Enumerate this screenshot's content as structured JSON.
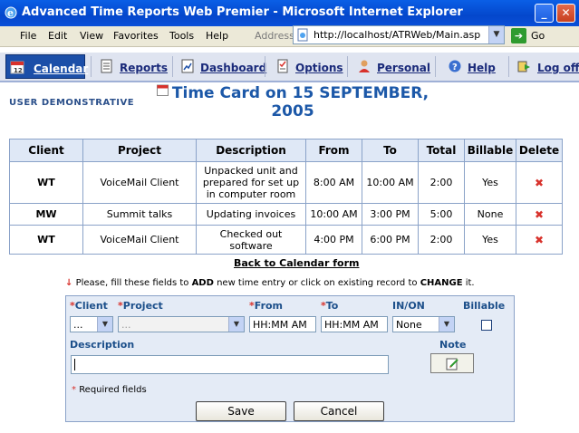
{
  "window": {
    "title": "Advanced Time Reports Web Premier - Microsoft Internet Explorer"
  },
  "menu": {
    "items": [
      "File",
      "Edit",
      "View",
      "Favorites",
      "Tools",
      "Help"
    ],
    "address_label": "Address",
    "url": "http://localhost/ATRWeb/Main.asp",
    "go_label": "Go"
  },
  "nav": {
    "tabs": [
      {
        "label": "Calendar",
        "icon": "calendar-icon",
        "active": true
      },
      {
        "label": "Reports",
        "icon": "document-icon"
      },
      {
        "label": "Dashboard",
        "icon": "chart-icon"
      },
      {
        "label": "Options",
        "icon": "checklist-icon"
      },
      {
        "label": "Personal",
        "icon": "person-icon"
      },
      {
        "label": "Help",
        "icon": "help-icon"
      },
      {
        "label": "Log off -",
        "icon": "logoff-icon"
      }
    ]
  },
  "header": {
    "user": "USER DEMONSTRATIVE",
    "title_line1": "Time Card on 15 SEPTEMBER,",
    "title_line2": "2005"
  },
  "table": {
    "headers": [
      "Client",
      "Project",
      "Description",
      "From",
      "To",
      "Total",
      "Billable",
      "Delete"
    ],
    "rows": [
      {
        "client": "WT",
        "project": "VoiceMail Client",
        "description": "Unpacked unit and prepared for set up in computer room",
        "from": "8:00 AM",
        "to": "10:00 AM",
        "total": "2:00",
        "billable": "Yes"
      },
      {
        "client": "MW",
        "project": "Summit talks",
        "description": "Updating invoices",
        "from": "10:00 AM",
        "to": "3:00 PM",
        "total": "5:00",
        "billable": "None"
      },
      {
        "client": "WT",
        "project": "VoiceMail Client",
        "description": "Checked out software",
        "from": "4:00 PM",
        "to": "6:00 PM",
        "total": "2:00",
        "billable": "Yes"
      }
    ],
    "delete_glyph": "✖"
  },
  "back_link": "Back to Calendar form",
  "instruction": {
    "before_add": "Please, fill these fields to ",
    "add": "ADD",
    "middle": " new time entry or click on existing record to ",
    "change": "CHANGE",
    "after": " it."
  },
  "form": {
    "labels": {
      "client": "Client",
      "project": "Project",
      "from": "From",
      "to": "To",
      "inon": "IN/ON",
      "billable": "Billable",
      "description": "Description",
      "note": "Note"
    },
    "required_mark": "*",
    "client_value": "...",
    "project_value": "...",
    "from_value": "HH:MM AM",
    "to_value": "HH:MM AM",
    "inon_value": "None",
    "billable_checked": false,
    "description_value": "",
    "required_note": "Required fields",
    "save_label": "Save",
    "cancel_label": "Cancel"
  }
}
